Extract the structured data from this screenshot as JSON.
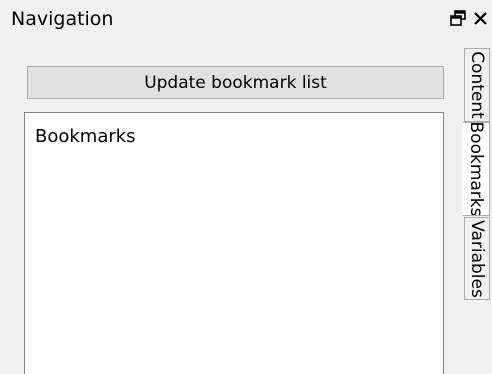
{
  "panel": {
    "title": "Navigation",
    "float_icon": "float-window-icon",
    "close_icon": "close-icon"
  },
  "toolbar": {
    "update_label": "Update bookmark list"
  },
  "bookmarks": {
    "header": "Bookmarks",
    "items": []
  },
  "tabs": [
    {
      "label": "Content",
      "active": false
    },
    {
      "label": "Bookmarks",
      "active": true
    },
    {
      "label": "Variables",
      "active": false
    }
  ],
  "colors": {
    "panel_bg": "#f0f0f0",
    "button_bg": "#e1e1e1",
    "list_bg": "#ffffff",
    "border": "#adadad"
  }
}
